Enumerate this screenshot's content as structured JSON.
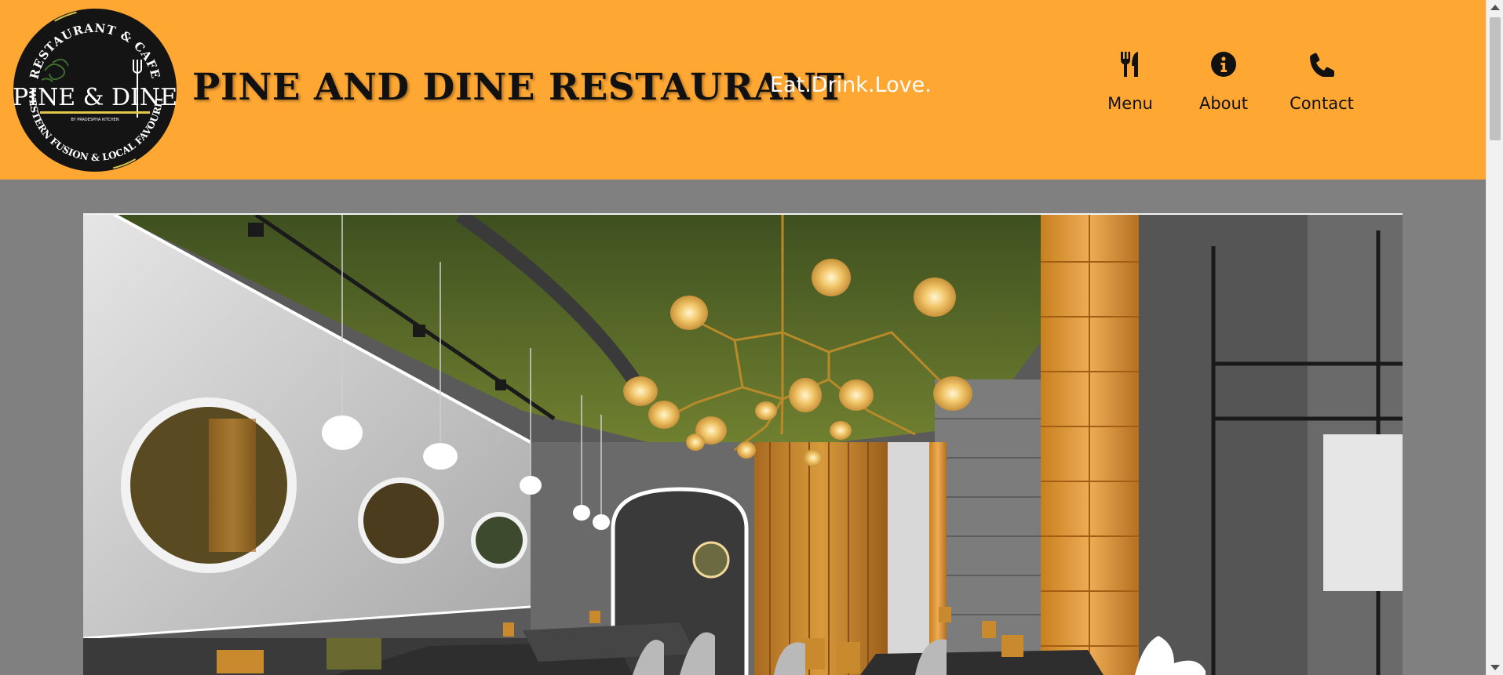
{
  "header": {
    "title": "PINE AND DINE RESTAURANT",
    "tagline": "Eat.Drink.Love.",
    "background_color": "#ffa733"
  },
  "logo": {
    "top_text": "RESTAURANT & CAFE",
    "brand": "PINE & DINE",
    "byline": "BY PRADESPHA KITCHEN",
    "bottom_text": "WESTERN FUSION & LOCAL FAVOURITE"
  },
  "nav": {
    "items": [
      {
        "label": "Menu",
        "icon": "utensils-icon"
      },
      {
        "label": "About",
        "icon": "info-circle-icon"
      },
      {
        "label": "Contact",
        "icon": "phone-icon"
      }
    ]
  },
  "hero": {
    "image": "restaurant-interior-photo",
    "description_colors": {
      "ceiling": "#4a5a24",
      "wood": "#c98a2e",
      "brick": "#e09a3a"
    }
  },
  "colors": {
    "page_background": "#808080",
    "text_dark": "#111111",
    "text_light": "#ffffff"
  }
}
